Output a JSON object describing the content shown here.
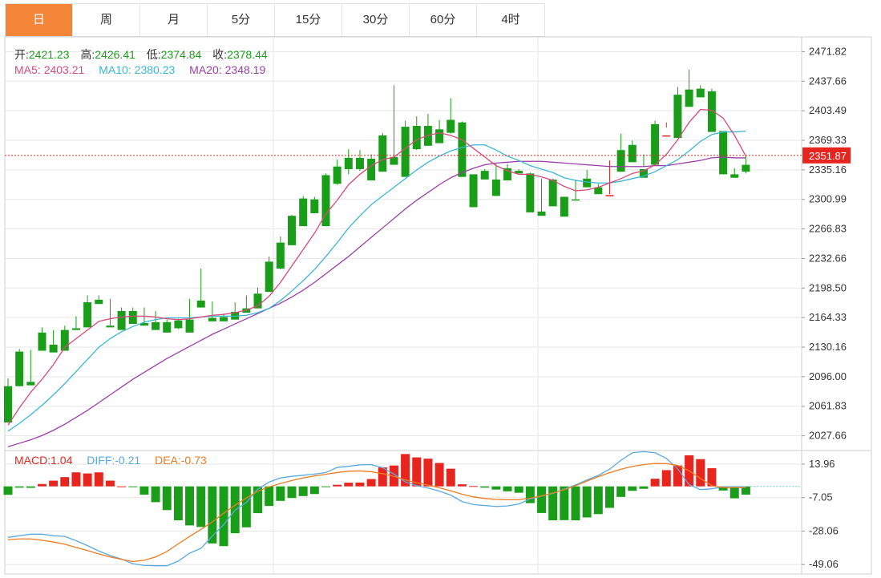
{
  "tabs": [
    {
      "label": "日",
      "active": true
    },
    {
      "label": "周",
      "active": false
    },
    {
      "label": "月",
      "active": false
    },
    {
      "label": "5分",
      "active": false
    },
    {
      "label": "15分",
      "active": false
    },
    {
      "label": "30分",
      "active": false
    },
    {
      "label": "60分",
      "active": false
    },
    {
      "label": "4时",
      "active": false
    }
  ],
  "ohlc": {
    "open_label": "开:",
    "open": "2421.23",
    "high_label": "高:",
    "high": "2426.41",
    "low_label": "低:",
    "low": "2374.84",
    "close_label": "收:",
    "close": "2378.44"
  },
  "ma": {
    "ma5_label": "MA5:",
    "ma5": "2403.21",
    "ma10_label": "MA10:",
    "ma10": "2380.23",
    "ma20_label": "MA20:",
    "ma20": "2348.19"
  },
  "macd": {
    "macd_label": "MACD:",
    "macd": "1.04",
    "diff_label": "DIFF:",
    "diff": "-0.21",
    "dea_label": "DEA:",
    "dea": "-0.73"
  },
  "colors": {
    "up": "#e8241e",
    "down": "#1a9e1a",
    "ma5": "#d9497a",
    "ma10": "#3ab7d6",
    "ma20": "#9b3fa8",
    "diff": "#5aa9e0",
    "dea": "#ef7b20",
    "price_tag": "#e8241e",
    "label_green": "#1a9e1a",
    "grid": "#e6e6e6"
  },
  "chart_data": {
    "type": "candlestick",
    "price_axis": {
      "ticks": [
        "2471.82",
        "2437.66",
        "2403.49",
        "2369.33",
        "2335.16",
        "2300.99",
        "2266.83",
        "2232.66",
        "2198.50",
        "2164.33",
        "2130.16",
        "2096.00",
        "2061.83",
        "2027.66"
      ],
      "range": [
        2010.6,
        2488.9
      ]
    },
    "current_price": "2351.87",
    "candles": [
      [
        2085,
        2094,
        2045,
        2043
      ],
      [
        2125,
        2128,
        2085,
        2085
      ],
      [
        2090,
        2127,
        2090,
        2086
      ],
      [
        2147,
        2153,
        2128,
        2126
      ],
      [
        2133,
        2150,
        2125,
        2124
      ],
      [
        2150,
        2155,
        2128,
        2126
      ],
      [
        2152,
        2166,
        2152,
        2150
      ],
      [
        2182,
        2190,
        2155,
        2153
      ],
      [
        2185,
        2190,
        2181,
        2180
      ],
      [
        2155,
        2186,
        2155,
        2153
      ],
      [
        2172,
        2176,
        2152,
        2150
      ],
      [
        2172,
        2176,
        2159,
        2157
      ],
      [
        2158,
        2176,
        2158,
        2155
      ],
      [
        2159,
        2172,
        2150,
        2150
      ],
      [
        2159,
        2162,
        2150,
        2147
      ],
      [
        2161,
        2163,
        2151,
        2152
      ],
      [
        2162,
        2186,
        2160,
        2147
      ],
      [
        2184,
        2221,
        2176,
        2176
      ],
      [
        2164,
        2183,
        2164,
        2160
      ],
      [
        2165,
        2169,
        2165,
        2160
      ],
      [
        2171,
        2182,
        2164,
        2162
      ],
      [
        2175,
        2190,
        2175,
        2170
      ],
      [
        2192,
        2199,
        2175,
        2175
      ],
      [
        2229,
        2235,
        2194,
        2194
      ],
      [
        2251,
        2258,
        2220,
        2221
      ],
      [
        2282,
        2283,
        2251,
        2248
      ],
      [
        2302,
        2305,
        2275,
        2270
      ],
      [
        2301,
        2304,
        2290,
        2285
      ],
      [
        2329,
        2331,
        2290,
        2270
      ],
      [
        2339,
        2347,
        2318,
        2319
      ],
      [
        2349,
        2359,
        2330,
        2336
      ],
      [
        2349,
        2358,
        2334,
        2336
      ],
      [
        2348,
        2353,
        2324,
        2323
      ],
      [
        2375,
        2378,
        2334,
        2333
      ],
      [
        2350,
        2433,
        2342,
        2341
      ],
      [
        2385,
        2392,
        2339,
        2327
      ],
      [
        2386,
        2397,
        2358,
        2359
      ],
      [
        2386,
        2400,
        2363,
        2363
      ],
      [
        2382,
        2393,
        2366,
        2366
      ],
      [
        2393,
        2418,
        2377,
        2378
      ],
      [
        2390,
        2391,
        2328,
        2327
      ],
      [
        2330,
        2330,
        2330,
        2292
      ],
      [
        2334,
        2336,
        2325,
        2324
      ],
      [
        2324,
        2342,
        2305,
        2305
      ],
      [
        2337,
        2342,
        2324,
        2323
      ],
      [
        2334,
        2336,
        2332,
        2331
      ],
      [
        2331,
        2332,
        2287,
        2286
      ],
      [
        2287,
        2325,
        2285,
        2282
      ],
      [
        2324,
        2325,
        2295,
        2293
      ],
      [
        2304,
        2304,
        2302,
        2281
      ],
      [
        2301,
        2324,
        2301,
        2300
      ],
      [
        2325,
        2335,
        2315,
        2315
      ],
      [
        2315,
        2319,
        2308,
        2307
      ],
      [
        2305,
        2346,
        2307,
        2306
      ],
      [
        2358,
        2377,
        2333,
        2333
      ],
      [
        2364,
        2369,
        2355,
        2344
      ],
      [
        2336,
        2339,
        2353,
        2326
      ],
      [
        2388,
        2392,
        2341,
        2341
      ],
      [
        2375,
        2390,
        2384,
        2375
      ],
      [
        2422,
        2431,
        2373,
        2372
      ],
      [
        2428,
        2451,
        2421,
        2408
      ],
      [
        2429,
        2433,
        2424,
        2419
      ],
      [
        2426,
        2429,
        2380,
        2379
      ],
      [
        2380,
        2380,
        2331,
        2330
      ],
      [
        2330,
        2337,
        2328,
        2326
      ],
      [
        2341,
        2351,
        2331,
        2333
      ]
    ],
    "ma5": [
      2040,
      2060,
      2078,
      2093,
      2110,
      2130,
      2140,
      2150,
      2160,
      2163,
      2165,
      2166,
      2166,
      2165,
      2163,
      2162,
      2163,
      2165,
      2167,
      2168,
      2170,
      2173,
      2178,
      2189,
      2205,
      2224,
      2243,
      2262,
      2284,
      2300,
      2318,
      2330,
      2340,
      2347,
      2350,
      2360,
      2370,
      2375,
      2378,
      2375,
      2370,
      2360,
      2350,
      2340,
      2334,
      2330,
      2330,
      2327,
      2323,
      2316,
      2311,
      2312,
      2315,
      2320,
      2325,
      2331,
      2334,
      2341,
      2353,
      2370,
      2390,
      2405,
      2404,
      2395,
      2375,
      2351
    ],
    "ma10": [
      2033,
      2042,
      2052,
      2063,
      2075,
      2088,
      2102,
      2116,
      2130,
      2140,
      2148,
      2154,
      2159,
      2162,
      2164,
      2164,
      2164,
      2165,
      2166,
      2166,
      2166,
      2167,
      2170,
      2175,
      2184,
      2195,
      2207,
      2220,
      2235,
      2251,
      2268,
      2282,
      2295,
      2305,
      2315,
      2325,
      2335,
      2344,
      2351,
      2357,
      2361,
      2364,
      2364,
      2358,
      2351,
      2346,
      2340,
      2336,
      2332,
      2326,
      2323,
      2321,
      2320,
      2320,
      2322,
      2325,
      2328,
      2333,
      2340,
      2347,
      2357,
      2368,
      2376,
      2379,
      2379,
      2380
    ],
    "ma20": [
      2015,
      2019,
      2023,
      2028,
      2034,
      2041,
      2049,
      2057,
      2066,
      2075,
      2084,
      2093,
      2101,
      2109,
      2117,
      2124,
      2131,
      2138,
      2145,
      2151,
      2157,
      2163,
      2169,
      2175,
      2181,
      2188,
      2196,
      2205,
      2215,
      2225,
      2235,
      2246,
      2257,
      2268,
      2279,
      2290,
      2300,
      2309,
      2318,
      2326,
      2332,
      2337,
      2341,
      2343,
      2344,
      2345,
      2345,
      2345,
      2344,
      2343,
      2342,
      2341,
      2340,
      2339,
      2339,
      2339,
      2339,
      2340,
      2340,
      2342,
      2344,
      2346,
      2349,
      2350,
      2349,
      2349
    ],
    "macd_axis": {
      "ticks": [
        "13.96",
        "-7.05",
        "-28.06",
        "-49.06"
      ],
      "range": [
        -55.0,
        22.5
      ]
    },
    "macd_hist": [
      -5.3,
      -0.8,
      -0.9,
      1.5,
      3.6,
      5.8,
      8.8,
      8.1,
      8.8,
      3.6,
      0,
      -0.5,
      -5.2,
      -9.9,
      -14.9,
      -21.3,
      -24.5,
      -25.5,
      -35.8,
      -37.5,
      -29.4,
      -25.7,
      -16.8,
      -12.3,
      -9.1,
      -7.3,
      -6.1,
      -4.8,
      -0.1,
      1.0,
      2.3,
      2.4,
      4.6,
      11.9,
      13.1,
      20.3,
      18.2,
      17.4,
      14.7,
      11.1,
      1.3,
      0.2,
      -0.8,
      -2.0,
      -3.1,
      -4.0,
      -10.5,
      -16.7,
      -21.3,
      -21.2,
      -21.3,
      -19.5,
      -17.4,
      -13.5,
      -6.6,
      -2.8,
      -1.5,
      4.8,
      10.2,
      13.1,
      19.5,
      17.1,
      11.4,
      -2.6,
      -7.5,
      -5.2
    ],
    "macd_diff": [
      -32.0,
      -31.0,
      -30.0,
      -30.0,
      -31.0,
      -31.4,
      -34.1,
      -37.2,
      -40.6,
      -43.4,
      -45.6,
      -48.6,
      -49.6,
      -49.8,
      -49.8,
      -46.9,
      -41.9,
      -38.9,
      -31.2,
      -24.0,
      -15.0,
      -10.1,
      -1.8,
      2.7,
      5.3,
      6.3,
      7.0,
      7.7,
      8.7,
      11.9,
      12.6,
      13.5,
      13.7,
      11.7,
      7.7,
      2.8,
      0.5,
      -1.0,
      -3.0,
      -5.5,
      -9.5,
      -11.4,
      -12.0,
      -12.6,
      -12.3,
      -11.1,
      -7.9,
      -6.1,
      -4.4,
      -1.7,
      0.9,
      4.0,
      6.9,
      10.8,
      16.4,
      21.1,
      21.8,
      21.1,
      17.6,
      10.9,
      1.1,
      -2.0,
      -1.5,
      -0.3,
      -0.2,
      -0.2
    ],
    "macd_dea": [
      -33.5,
      -33.0,
      -33.0,
      -33.8,
      -34.9,
      -36.3,
      -38.3,
      -40.3,
      -42.4,
      -44.3,
      -45.8,
      -47.2,
      -46.4,
      -44.3,
      -40.9,
      -36.0,
      -31.4,
      -27.0,
      -22.3,
      -16.8,
      -11.8,
      -7.3,
      -3.0,
      -0.3,
      1.8,
      3.7,
      5.3,
      6.6,
      7.6,
      8.7,
      9.5,
      9.7,
      9.2,
      8.0,
      6.3,
      4.1,
      2.3,
      0.8,
      -0.9,
      -2.8,
      -4.9,
      -6.6,
      -7.6,
      -8.2,
      -8.4,
      -8.4,
      -7.4,
      -6.0,
      -4.2,
      -2.1,
      0.4,
      3.3,
      6.1,
      8.6,
      10.8,
      12.5,
      13.7,
      14.4,
      14.3,
      13.1,
      9.8,
      5.0,
      0.4,
      -0.7,
      -0.7,
      -0.73
    ]
  }
}
